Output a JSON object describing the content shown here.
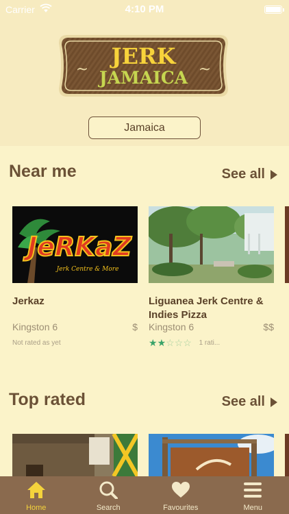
{
  "status_bar": {
    "carrier": "Carrier",
    "time": "4:10 PM"
  },
  "logo": {
    "line1": "JERK",
    "line2": "JAMAICA",
    "ornament": "~"
  },
  "location": {
    "label": "Jamaica"
  },
  "sections": {
    "near_me": {
      "title": "Near me",
      "see_all": "See all",
      "cards": [
        {
          "name": "Jerkaz",
          "location": "Kingston 6",
          "price": "$",
          "rating_text": "Not rated as yet",
          "stars": 0
        },
        {
          "name": "Liguanea Jerk Centre & Indies Pizza",
          "location": "Kingston 6",
          "price": "$$",
          "rating_text": "1 rati...",
          "stars": 2
        }
      ]
    },
    "top_rated": {
      "title": "Top rated",
      "see_all": "See all"
    }
  },
  "tabbar": {
    "items": [
      {
        "label": "Home",
        "icon": "home-icon",
        "active": true
      },
      {
        "label": "Search",
        "icon": "search-icon",
        "active": false
      },
      {
        "label": "Favourites",
        "icon": "heart-icon",
        "active": false
      },
      {
        "label": "Menu",
        "icon": "menu-icon",
        "active": false
      }
    ]
  },
  "colors": {
    "brand_brown": "#6b5136",
    "accent_yellow": "#f4d33c",
    "background": "#fbf3c9",
    "star_green": "#3aa36a"
  }
}
